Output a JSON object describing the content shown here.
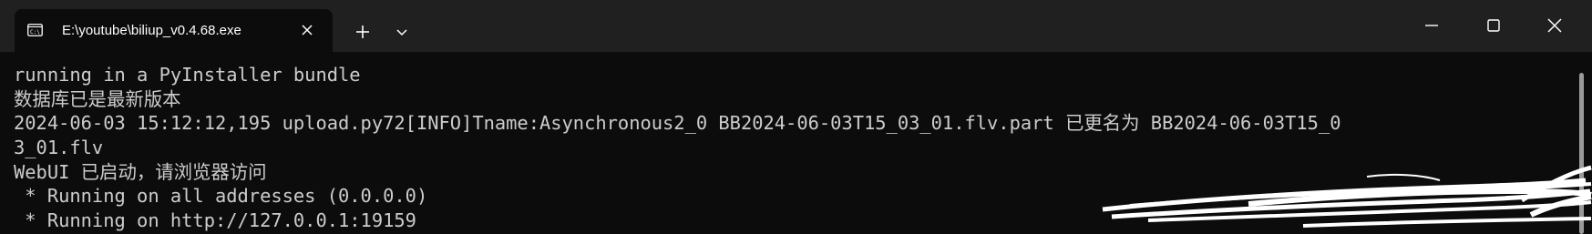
{
  "tab": {
    "title": "E:\\youtube\\biliup_v0.4.68.exe",
    "icon": "terminal-icon"
  },
  "titlebar": {
    "new_tab_icon": "plus-icon",
    "dropdown_icon": "chevron-down-icon",
    "minimize_icon": "minimize-icon",
    "maximize_icon": "maximize-icon",
    "close_icon": "close-icon"
  },
  "console": {
    "lines": [
      "running in a PyInstaller bundle",
      "数据库已是最新版本",
      "2024-06-03 15:12:12,195 upload.py72[INFO]Tname:Asynchronous2_0 BB2024-06-03T15_03_01.flv.part 已更名为 BB2024-06-03T15_0",
      "3_01.flv",
      "WebUI 已启动，请浏览器访问",
      " * Running on all addresses (0.0.0.0)",
      " * Running on http://127.0.0.1:19159"
    ]
  },
  "colors": {
    "titlebar_bg": "#202020",
    "terminal_bg": "#0c0c0c",
    "terminal_text": "#cccccc"
  }
}
